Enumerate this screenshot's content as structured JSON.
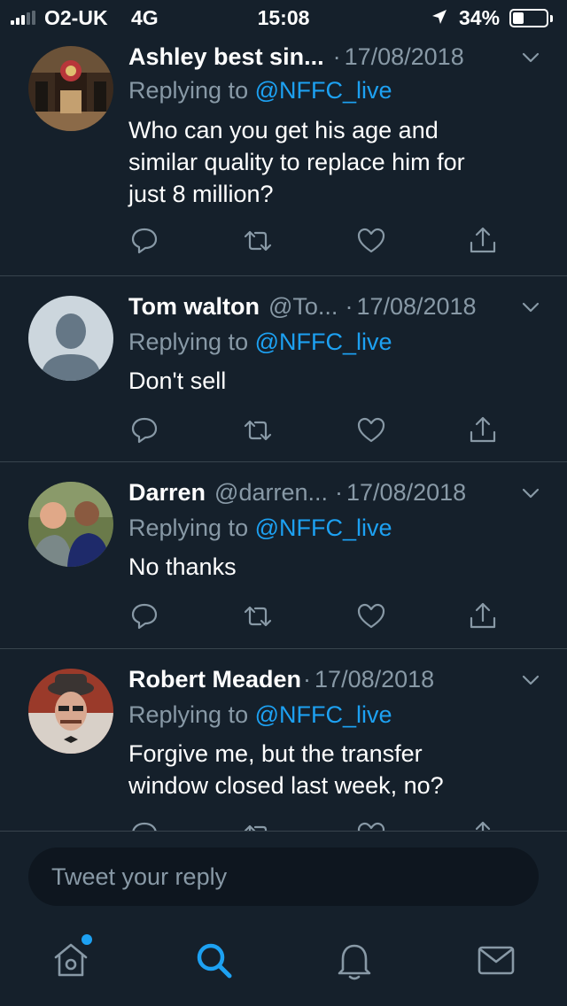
{
  "status_bar": {
    "carrier": "O2-UK",
    "network": "4G",
    "time": "15:08",
    "battery_percent": "34%",
    "battery_level": 0.34
  },
  "tweets": [
    {
      "name": "Ashley best sin...",
      "handle": "",
      "separator": "·",
      "date": "17/08/2018",
      "replying_prefix": "Replying to ",
      "replying_to": "@NFFC_live",
      "lines": [
        "Who can you get his age and",
        "similar quality to replace him for",
        "just  8 million?"
      ]
    },
    {
      "name": "Tom walton",
      "handle": "@To...",
      "separator": "·",
      "date": "17/08/2018",
      "replying_prefix": "Replying to ",
      "replying_to": "@NFFC_live",
      "lines": [
        "Don't sell"
      ]
    },
    {
      "name": "Darren",
      "handle": "@darren...",
      "separator": "·",
      "date": "17/08/2018",
      "replying_prefix": "Replying to ",
      "replying_to": "@NFFC_live",
      "lines": [
        "No thanks"
      ]
    },
    {
      "name": "Robert Meaden",
      "handle": "",
      "separator": "·",
      "date": "17/08/2018",
      "replying_prefix": "Replying to ",
      "replying_to": "@NFFC_live",
      "lines": [
        "Forgive me, but the transfer",
        "window closed last week, no?"
      ]
    }
  ],
  "composer": {
    "placeholder": "Tweet your reply"
  },
  "tab_bar": {
    "items": [
      "home-icon",
      "search-icon",
      "notifications-icon",
      "messages-icon"
    ],
    "active": "search-icon"
  },
  "colors": {
    "background": "#15202b",
    "accent": "#1da1f2",
    "secondary_text": "#8899a6",
    "divider": "#38444d"
  }
}
